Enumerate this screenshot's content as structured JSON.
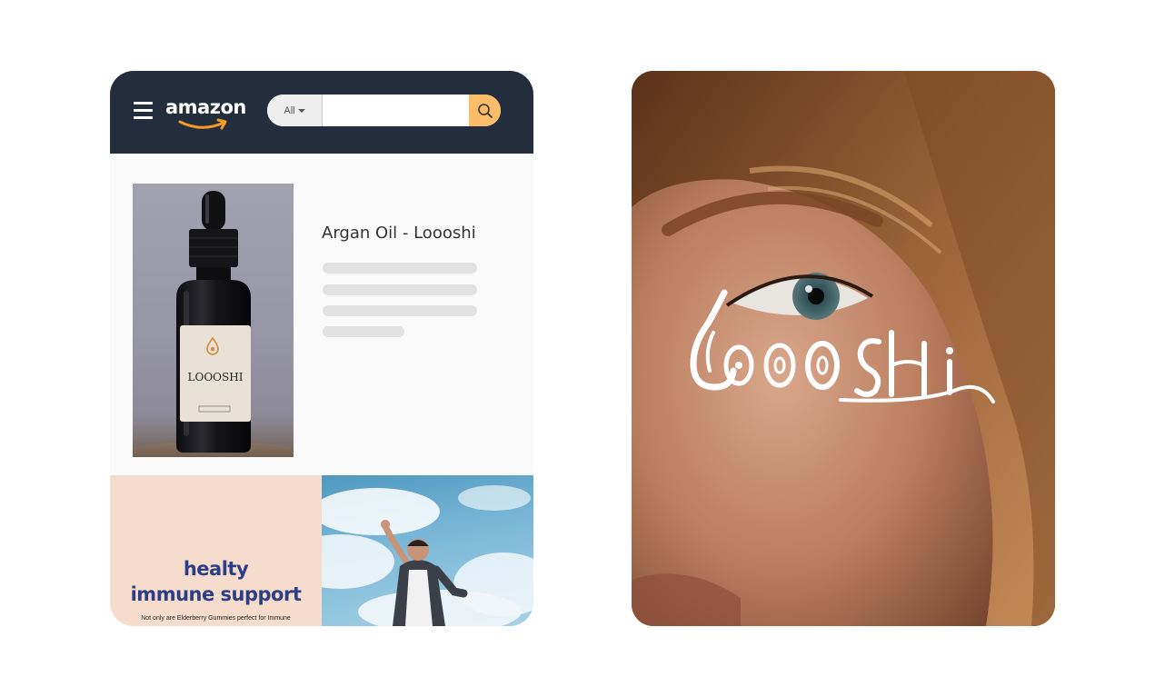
{
  "header": {
    "logo_text": "amazon",
    "search": {
      "category": "All",
      "placeholder": "",
      "value": ""
    },
    "icons": {
      "menu": "hamburger-menu-icon",
      "search": "magnifier-icon"
    },
    "colors": {
      "bar": "#222d3e",
      "search_button": "#fbbd6a",
      "smile": "#f59a22"
    }
  },
  "product": {
    "title": "Argan Oil - Loooshi",
    "label_brand": "LOOOSHI"
  },
  "banner": {
    "headline_line1": "healty",
    "headline_line2": "immune support",
    "small_text": "Not only are Elderberry Gummies perfect for Immune",
    "colors": {
      "panel": "#f5dccc",
      "headline": "#2e3e84"
    }
  },
  "brand": {
    "logo_text": "LOOOSHI",
    "logo_color": "#ffffff"
  }
}
